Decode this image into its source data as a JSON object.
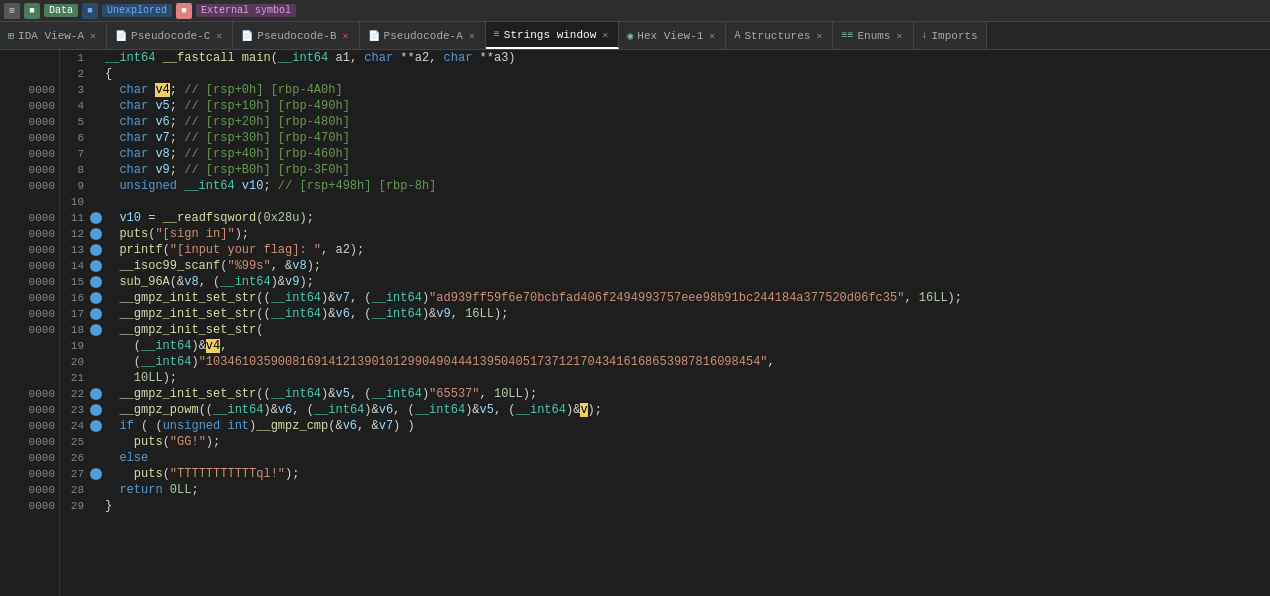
{
  "topbar": {
    "icons": [
      "grid",
      "data",
      "unexplored",
      "external_symbol"
    ],
    "data_label": "Data",
    "unexplored_label": "Unexplored",
    "external_label": "External symbol"
  },
  "tabs": [
    {
      "id": "ida-view-a",
      "label": "IDA View-A",
      "icon": "⊞",
      "active": false,
      "closable": true
    },
    {
      "id": "pseudocode-c",
      "label": "Pseudocode-C",
      "icon": "📄",
      "active": false,
      "closable": true
    },
    {
      "id": "pseudocode-b",
      "label": "Pseudocode-B",
      "icon": "📄",
      "active": false,
      "closable": true
    },
    {
      "id": "pseudocode-a",
      "label": "Pseudocode-A",
      "icon": "📄",
      "active": false,
      "closable": true
    },
    {
      "id": "strings-window",
      "label": "Strings window",
      "icon": "≡",
      "active": true,
      "closable": true
    },
    {
      "id": "hex-view-1",
      "label": "Hex View-1",
      "icon": "◉",
      "active": false,
      "closable": true
    },
    {
      "id": "structures",
      "label": "Structures",
      "icon": "A",
      "active": false,
      "closable": true
    },
    {
      "id": "enums",
      "label": "Enums",
      "icon": "≡≡",
      "active": false,
      "closable": true
    },
    {
      "id": "imports",
      "label": "Imports",
      "icon": "↓",
      "active": false,
      "closable": false
    }
  ],
  "addresses": [
    "",
    "",
    "0000",
    "0000",
    "0000",
    "0000",
    "0000",
    "0000",
    "0000",
    "",
    "0000",
    "0000",
    "0000",
    "0000",
    "0000",
    "0000",
    "0000",
    "0000",
    "",
    "",
    "",
    "0000",
    "0000",
    "0000",
    "0000",
    "0000",
    "0000",
    "0000",
    "0000"
  ],
  "lines": [
    {
      "num": 1,
      "bp": false,
      "html": "<span class='type'>__int64</span> <span class='fn'>__fastcall</span> <span class='fn'>main</span><span class='punc'>(</span><span class='type'>__int64</span> a1<span class='punc'>,</span> <span class='kw'>char</span> <span class='punc'>**</span>a2<span class='punc'>,</span> <span class='kw'>char</span> <span class='punc'>**</span>a3<span class='punc'>)</span>"
    },
    {
      "num": 2,
      "bp": false,
      "html": "<span class='punc'>{</span>"
    },
    {
      "num": 3,
      "bp": false,
      "html": "  <span class='kw'>char</span> <span class='hl'>v4</span><span class='punc'>;</span> <span class='comment'>// [rsp+0h] [rbp-4A0h]</span>"
    },
    {
      "num": 4,
      "bp": false,
      "html": "  <span class='kw'>char</span> <span class='var'>v5</span><span class='punc'>;</span> <span class='comment'>// [rsp+10h] [rbp-490h]</span>"
    },
    {
      "num": 5,
      "bp": false,
      "html": "  <span class='kw'>char</span> <span class='var'>v6</span><span class='punc'>;</span> <span class='comment'>// [rsp+20h] [rbp-480h]</span>"
    },
    {
      "num": 6,
      "bp": false,
      "html": "  <span class='kw'>char</span> <span class='var'>v7</span><span class='punc'>;</span> <span class='comment'>// [rsp+30h] [rbp-470h]</span>"
    },
    {
      "num": 7,
      "bp": false,
      "html": "  <span class='kw'>char</span> <span class='var'>v8</span><span class='punc'>;</span> <span class='comment'>// [rsp+40h] [rbp-460h]</span>"
    },
    {
      "num": 8,
      "bp": false,
      "html": "  <span class='kw'>char</span> <span class='var'>v9</span><span class='punc'>;</span> <span class='comment'>// [rsp+B0h] [rbp-3F0h]</span>"
    },
    {
      "num": 9,
      "bp": false,
      "html": "  <span class='kw'>unsigned</span> <span class='type'>__int64</span> <span class='var'>v10</span><span class='punc'>;</span> <span class='comment'>// [rsp+498h] [rbp-8h]</span>"
    },
    {
      "num": 10,
      "bp": false,
      "html": ""
    },
    {
      "num": 11,
      "bp": true,
      "html": "  <span class='var'>v10</span> <span class='punc'>=</span> <span class='fn'>__readfsqword</span><span class='punc'>(</span><span class='num'>0x28u</span><span class='punc'>);</span>"
    },
    {
      "num": 12,
      "bp": true,
      "html": "  <span class='fn'>puts</span><span class='punc'>(</span><span class='str'>\"[sign in]\"</span><span class='punc'>);</span>"
    },
    {
      "num": 13,
      "bp": true,
      "html": "  <span class='fn'>printf</span><span class='punc'>(</span><span class='str'>\"[input your flag]: \"</span><span class='punc'>,</span> a2<span class='punc'>);</span>"
    },
    {
      "num": 14,
      "bp": true,
      "html": "  <span class='fn'>__isoc99_scanf</span><span class='punc'>(</span><span class='str'>\"%99s\"</span><span class='punc'>,</span> <span class='punc'>&amp;</span><span class='var'>v8</span><span class='punc'>);</span>"
    },
    {
      "num": 15,
      "bp": true,
      "html": "  <span class='fn'>sub_96A</span><span class='punc'>(&amp;</span><span class='var'>v8</span><span class='punc'>,</span> <span class='punc'>(</span><span class='type'>__int64</span><span class='punc'>)&amp;</span><span class='var'>v9</span><span class='punc'>);</span>"
    },
    {
      "num": 16,
      "bp": true,
      "html": "  <span class='fn'>__gmpz_init_set_str</span><span class='punc'>((</span><span class='type'>__int64</span><span class='punc'>)&amp;</span><span class='var'>v7</span><span class='punc'>,</span> <span class='punc'>(</span><span class='type'>__int64</span><span class='punc'>)</span><span class='str'>\"ad939ff59f6e70bcbfad406f2494993757eee98b91bc244184a377520d06fc35\"</span><span class='punc'>,</span> <span class='num'>16LL</span><span class='punc'>);</span>"
    },
    {
      "num": 17,
      "bp": true,
      "html": "  <span class='fn'>__gmpz_init_set_str</span><span class='punc'>((</span><span class='type'>__int64</span><span class='punc'>)&amp;</span><span class='var'>v6</span><span class='punc'>,</span> <span class='punc'>(</span><span class='type'>__int64</span><span class='punc'>)&amp;</span><span class='var'>v9</span><span class='punc'>,</span> <span class='num'>16LL</span><span class='punc'>);</span>"
    },
    {
      "num": 18,
      "bp": true,
      "html": "  <span class='fn'>__gmpz_init_set_str</span><span class='punc'>(</span>"
    },
    {
      "num": 19,
      "bp": false,
      "html": "    <span class='punc'>(</span><span class='type'>__int64</span><span class='punc'>)&amp;</span><span class='hl'>v4</span><span class='punc'>,</span>"
    },
    {
      "num": 20,
      "bp": false,
      "html": "    <span class='punc'>(</span><span class='type'>__int64</span><span class='punc'>)</span><span class='str'>\"10346103590081691412139010129904904441395040517371217043416168653987816098454\"</span><span class='punc'>,</span>"
    },
    {
      "num": 21,
      "bp": false,
      "html": "    <span class='num'>10LL</span><span class='punc'>);</span>"
    },
    {
      "num": 22,
      "bp": true,
      "html": "  <span class='fn'>__gmpz_init_set_str</span><span class='punc'>((</span><span class='type'>__int64</span><span class='punc'>)&amp;</span><span class='var'>v5</span><span class='punc'>,</span> <span class='punc'>(</span><span class='type'>__int64</span><span class='punc'>)</span><span class='str'>\"65537\"</span><span class='punc'>,</span> <span class='num'>10LL</span><span class='punc'>);</span>"
    },
    {
      "num": 23,
      "bp": true,
      "html": "  <span class='fn'>__gmpz_powm</span><span class='punc'>((</span><span class='type'>__int64</span><span class='punc'>)&amp;</span><span class='var'>v6</span><span class='punc'>,</span> <span class='punc'>(</span><span class='type'>__int64</span><span class='punc'>)&amp;</span><span class='var'>v6</span><span class='punc'>,</span> <span class='punc'>(</span><span class='type'>__int64</span><span class='punc'>)&amp;</span><span class='var'>v5</span><span class='punc'>,</span> <span class='punc'>(</span><span class='type'>__int64</span><span class='punc'>)&amp;</span><span class='hl2'>v</span><span class='punc'>);</span>"
    },
    {
      "num": 24,
      "bp": true,
      "html": "  <span class='kw'>if</span> <span class='punc'>(</span> <span class='punc'>(</span><span class='kw'>unsigned</span> <span class='kw'>int</span><span class='punc'>)</span><span class='fn'>__gmpz_cmp</span><span class='punc'>(&amp;</span><span class='var'>v6</span><span class='punc'>,</span> <span class='punc'>&amp;</span><span class='var'>v7</span><span class='punc'>)</span> <span class='punc'>)</span>"
    },
    {
      "num": 25,
      "bp": false,
      "html": "    <span class='fn'>puts</span><span class='punc'>(</span><span class='str'>\"GG!\"</span><span class='punc'>);</span>"
    },
    {
      "num": 26,
      "bp": false,
      "html": "  <span class='kw'>else</span>"
    },
    {
      "num": 27,
      "bp": true,
      "html": "    <span class='fn'>puts</span><span class='punc'>(</span><span class='str'>\"TTTTTTTTTTTql!\"</span><span class='punc'>);</span>"
    },
    {
      "num": 28,
      "bp": false,
      "html": "  <span class='kw'>return</span> <span class='num'>0LL</span><span class='punc'>;</span>"
    },
    {
      "num": 29,
      "bp": false,
      "html": "<span class='punc'>}</span>"
    }
  ]
}
